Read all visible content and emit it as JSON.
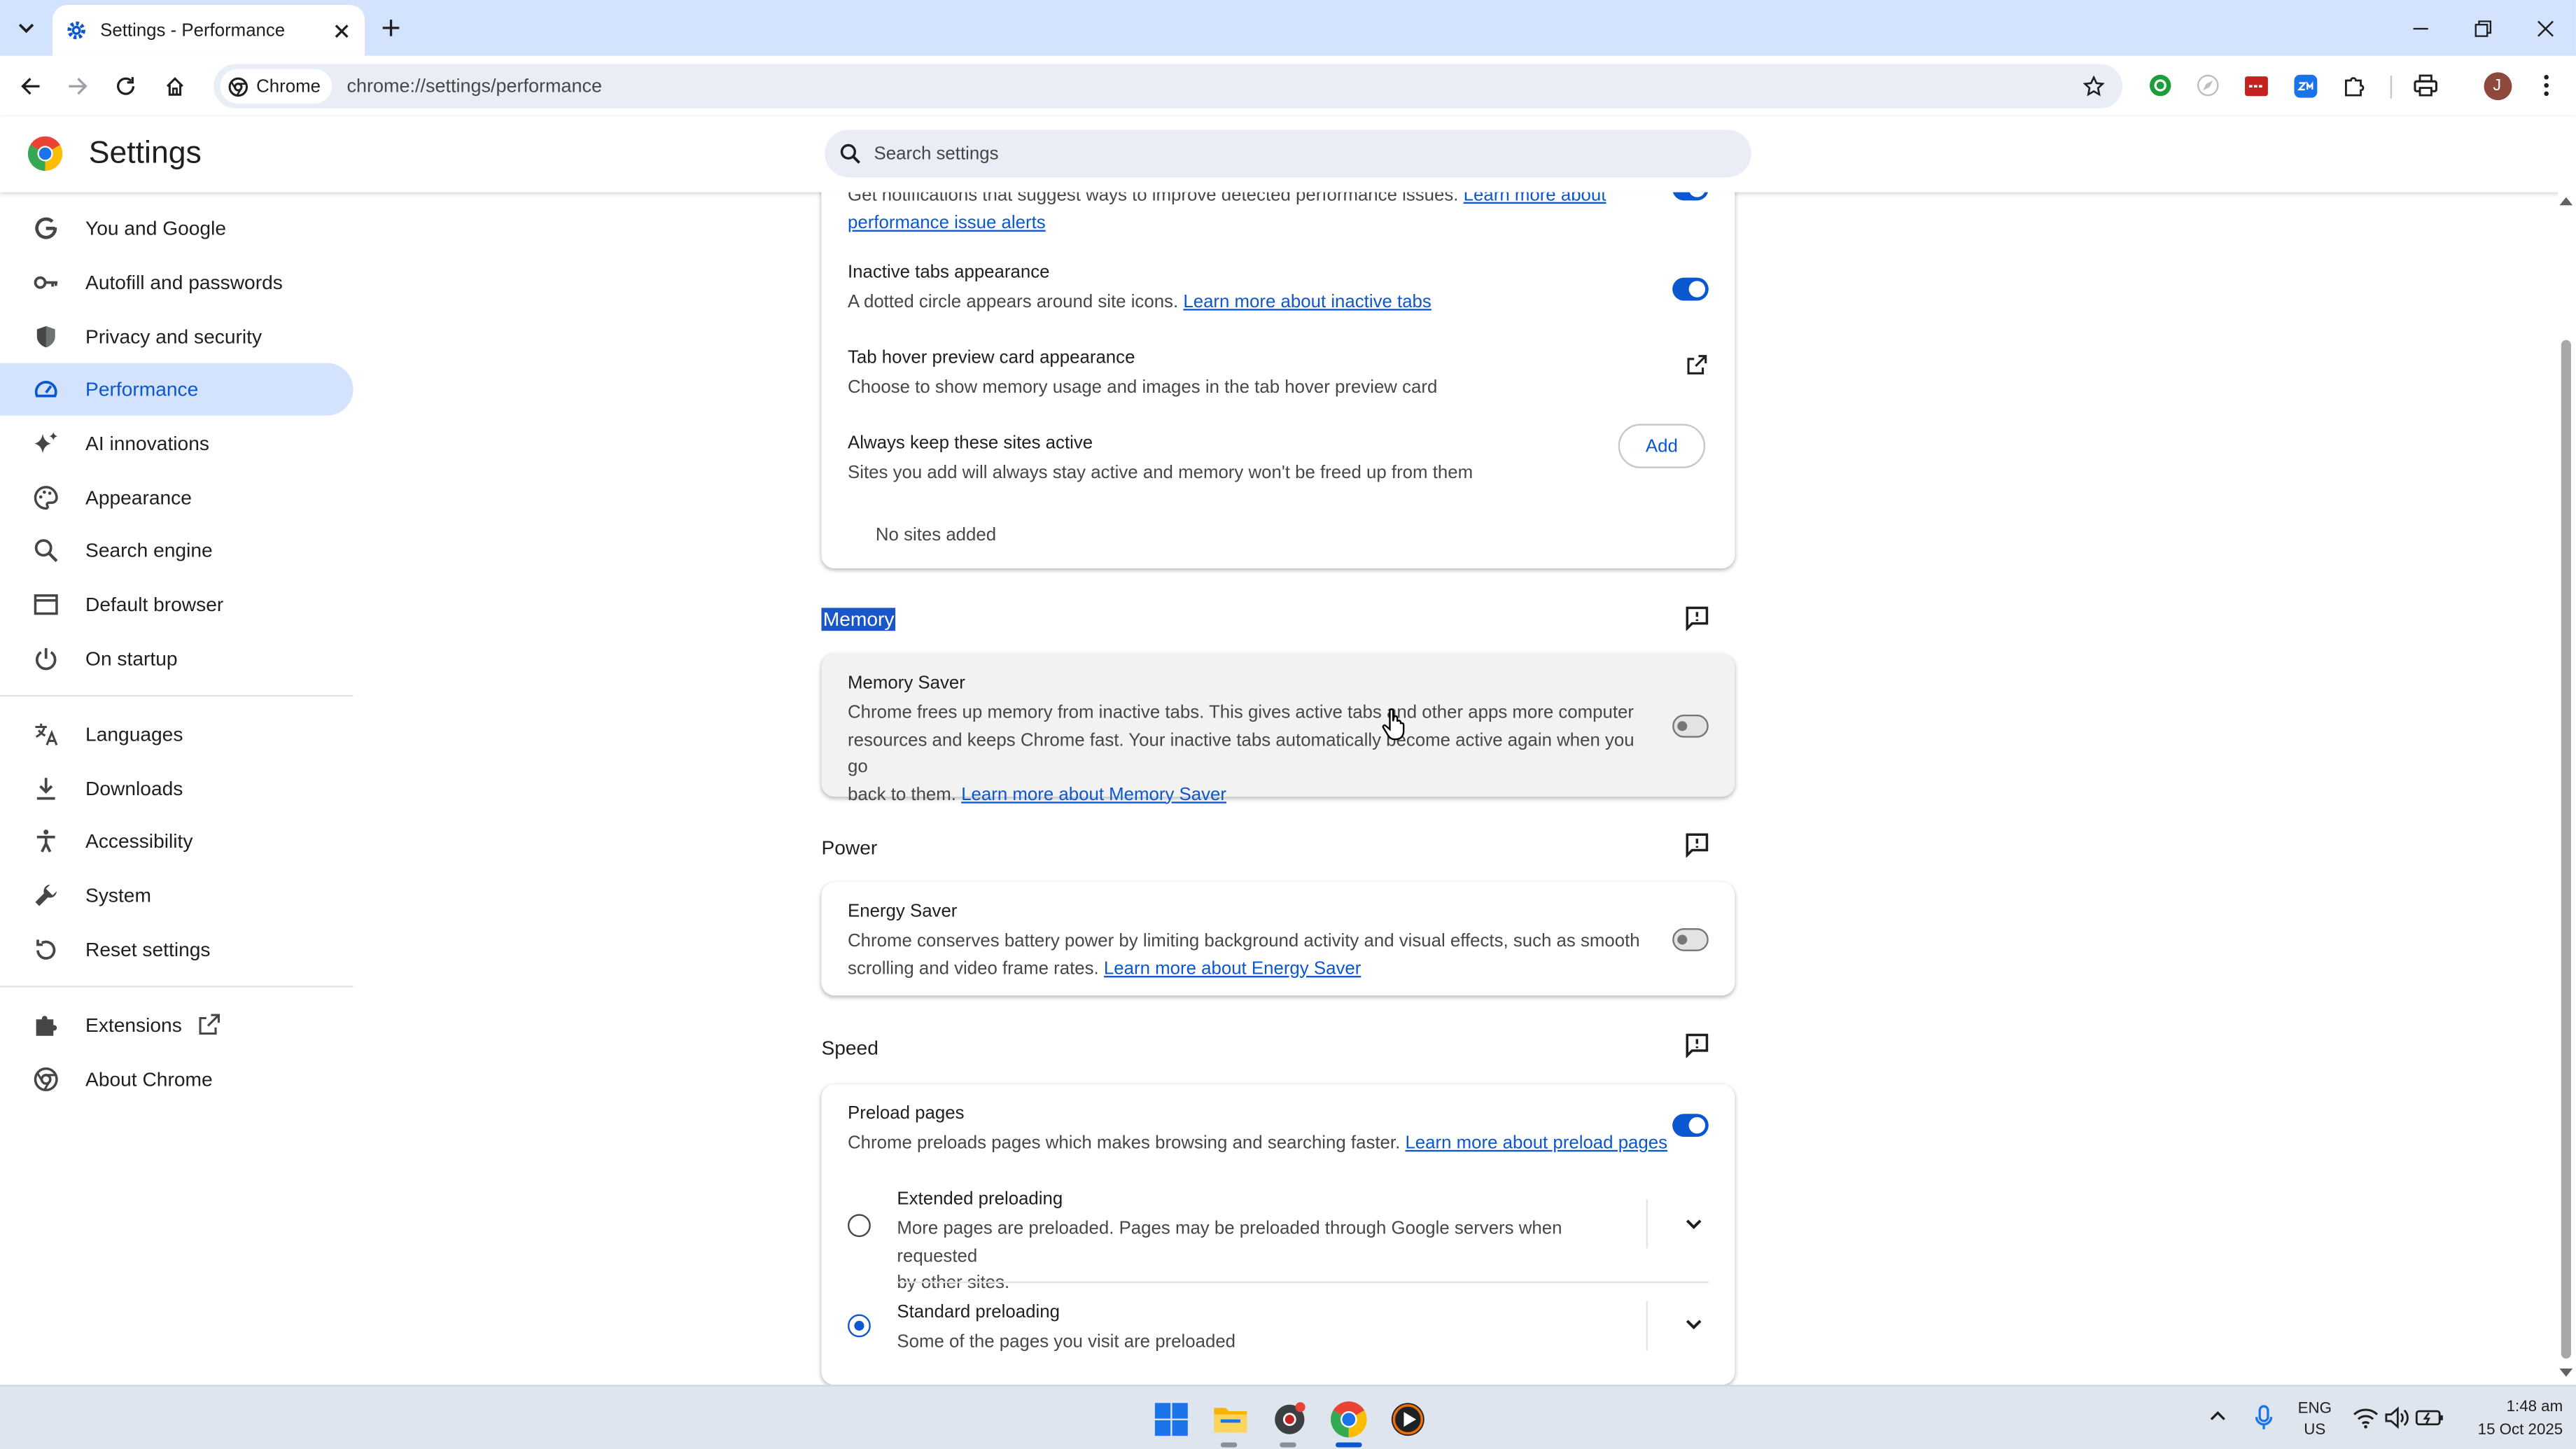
{
  "browser": {
    "tab_title": "Settings - Performance",
    "site_chip": "Chrome",
    "url": "chrome://settings/performance",
    "profile_initial": "J"
  },
  "header": {
    "title": "Settings",
    "search_placeholder": "Search settings"
  },
  "sidebar": {
    "items": [
      {
        "label": "You and Google",
        "icon": "google-g-icon"
      },
      {
        "label": "Autofill and passwords",
        "icon": "key-icon"
      },
      {
        "label": "Privacy and security",
        "icon": "shield-icon"
      },
      {
        "label": "Performance",
        "icon": "speedometer-icon",
        "active": true
      },
      {
        "label": "AI innovations",
        "icon": "sparkle-icon"
      },
      {
        "label": "Appearance",
        "icon": "palette-icon"
      },
      {
        "label": "Search engine",
        "icon": "search-icon"
      },
      {
        "label": "Default browser",
        "icon": "browser-window-icon"
      },
      {
        "label": "On startup",
        "icon": "power-icon"
      },
      {
        "label": "Languages",
        "icon": "translate-icon"
      },
      {
        "label": "Downloads",
        "icon": "download-icon"
      },
      {
        "label": "Accessibility",
        "icon": "accessibility-icon"
      },
      {
        "label": "System",
        "icon": "wrench-icon"
      },
      {
        "label": "Reset settings",
        "icon": "reset-icon"
      },
      {
        "label": "Extensions",
        "icon": "puzzle-icon"
      },
      {
        "label": "About Chrome",
        "icon": "chrome-icon"
      }
    ]
  },
  "general_card": {
    "alerts_desc_partial": "Get notifications that suggest ways to improve detected performance issues.",
    "alerts_link_1": "Learn more about",
    "alerts_link_2": "performance issue alerts",
    "alerts_on": true,
    "inactive_tabs_title": "Inactive tabs appearance",
    "inactive_tabs_desc": "A dotted circle appears around site icons.",
    "inactive_tabs_link": "Learn more about inactive tabs",
    "inactive_tabs_on": true,
    "hover_title": "Tab hover preview card appearance",
    "hover_desc": "Choose to show memory usage and images in the tab hover preview card",
    "active_sites_title": "Always keep these sites active",
    "active_sites_desc": "Sites you add will always stay active and memory won't be freed up from them",
    "add_button": "Add",
    "no_sites": "No sites added"
  },
  "memory": {
    "section_title": "Memory",
    "title": "Memory Saver",
    "desc_line1": "Chrome frees up memory from inactive tabs. This gives active tabs and other apps more computer",
    "desc_line2": "resources and keeps Chrome fast. Your inactive tabs automatically become active again when you go",
    "desc_line3": "back to them.",
    "link": "Learn more about Memory Saver",
    "on": false
  },
  "power": {
    "section_title": "Power",
    "title": "Energy Saver",
    "desc_line1": "Chrome conserves battery power by limiting background activity and visual effects, such as smooth",
    "desc_line2": "scrolling and video frame rates.",
    "link": "Learn more about Energy Saver",
    "on": false
  },
  "speed": {
    "section_title": "Speed",
    "title": "Preload pages",
    "desc": "Chrome preloads pages which makes browsing and searching faster.",
    "link": "Learn more about preload pages",
    "on": true,
    "options": [
      {
        "title": "Extended preloading",
        "desc_line1": "More pages are preloaded. Pages may be preloaded through Google servers when requested",
        "desc_line2": "by other sites.",
        "selected": false
      },
      {
        "title": "Standard preloading",
        "desc_line1": "Some of the pages you visit are preloaded",
        "desc_line2": "",
        "selected": true
      }
    ]
  },
  "taskbar": {
    "lang_1": "ENG",
    "lang_2": "US",
    "time": "1:48 am",
    "date": "15 Oct 2025"
  },
  "colors": {
    "accent": "#0b57d0",
    "active_nav_bg": "#d3e3fd",
    "tabstrip_bg": "#d3e3fd",
    "selection_bg": "#1a56c7"
  }
}
